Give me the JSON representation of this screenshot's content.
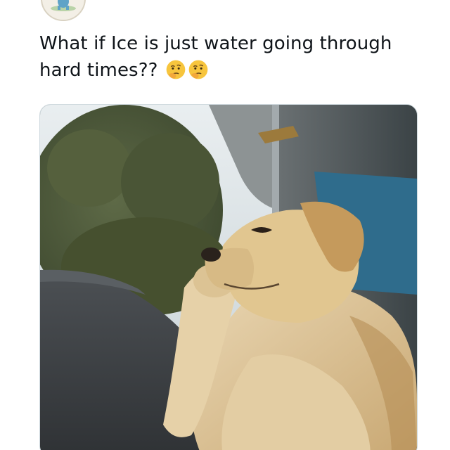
{
  "post": {
    "text": "What if Ice is just water going through hard times??",
    "emojis": [
      "thinking-face-icon",
      "thinking-face-icon"
    ]
  },
  "avatar": {
    "icon": "cartoon-figure-avatar-icon"
  },
  "media": {
    "type": "photo",
    "subject": "dog-thinking-photo"
  },
  "colors": {
    "text": "#0f1419",
    "media_border": "#cfd9de",
    "emoji_yellow": "#f7c53d"
  }
}
